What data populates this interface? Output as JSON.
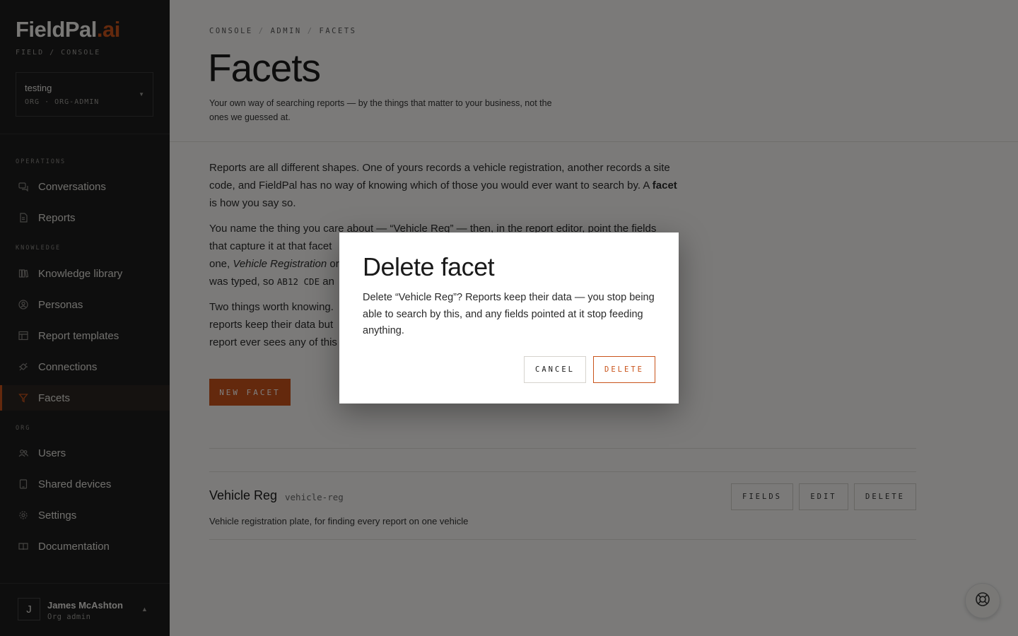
{
  "brand": {
    "name": "FieldPal",
    "tld": ".ai",
    "subtitle": "FIELD / CONSOLE",
    "accent_color": "#c9531a"
  },
  "org": {
    "name": "testing",
    "role": "ORG · ORG-ADMIN"
  },
  "sidebar": {
    "sections": [
      {
        "label": "OPERATIONS",
        "items": [
          {
            "label": "Conversations",
            "icon": "chat-icon"
          },
          {
            "label": "Reports",
            "icon": "document-icon"
          }
        ]
      },
      {
        "label": "KNOWLEDGE",
        "items": [
          {
            "label": "Knowledge library",
            "icon": "library-icon"
          },
          {
            "label": "Personas",
            "icon": "persona-icon"
          },
          {
            "label": "Report templates",
            "icon": "template-icon"
          },
          {
            "label": "Connections",
            "icon": "plug-icon"
          },
          {
            "label": "Facets",
            "icon": "filter-icon",
            "active": true
          }
        ]
      },
      {
        "label": "ORG",
        "items": [
          {
            "label": "Users",
            "icon": "users-icon"
          },
          {
            "label": "Shared devices",
            "icon": "device-icon"
          },
          {
            "label": "Settings",
            "icon": "gear-icon"
          },
          {
            "label": "Documentation",
            "icon": "book-icon"
          }
        ]
      }
    ]
  },
  "user": {
    "initial": "J",
    "name": "James McAshton",
    "role": "Org admin"
  },
  "breadcrumb": [
    "CONSOLE",
    "ADMIN",
    "FACETS"
  ],
  "page": {
    "title": "Facets",
    "subtitle": "Your own way of searching reports — by the things that matter to your business, not the ones we guessed at."
  },
  "body": {
    "p1_pre": "Reports are all different shapes. One of yours records a vehicle registration, another records a site code, and FieldPal has no way of knowing which of those you would ever want to search by. A ",
    "p1_bold": "facet",
    "p1_post": " is how you say so.",
    "p2_a": "You name the thing you care about — “Vehicle Reg” — then, in the report editor, point the fields",
    "p2_b": "that capture it at that facet",
    "p2_c_pre": "one, ",
    "p2_c_italic": "Vehicle Registration",
    "p2_c_post": " or",
    "p2_d_pre": "was typed, so ",
    "p2_d_mono": "AB12 CDE",
    "p2_d_post": " an",
    "p3_a": "Two things worth knowing.",
    "p3_b": "reports keep their data but",
    "p3_c": "report ever sees any of this"
  },
  "new_facet_label": "NEW FACET",
  "facets": [
    {
      "name": "Vehicle Reg",
      "slug": "vehicle-reg",
      "description": "Vehicle registration plate, for finding every report on one vehicle"
    }
  ],
  "row_actions": {
    "fields": "FIELDS",
    "edit": "EDIT",
    "delete": "DELETE"
  },
  "modal": {
    "title": "Delete facet",
    "body": "Delete “Vehicle Reg”? Reports keep their data — you stop being able to search by this, and any fields pointed at it stop feeding anything.",
    "cancel": "CANCEL",
    "confirm": "DELETE"
  }
}
